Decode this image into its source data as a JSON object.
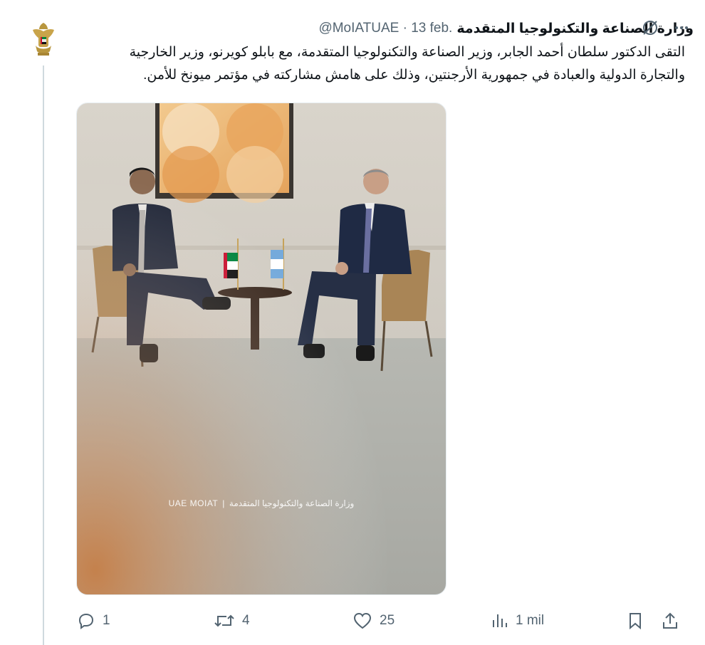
{
  "tweet": {
    "author_name": "وزارة الصناعة والتكنولوجيا المتقدمة",
    "handle": "@MoIATUAE",
    "separator": "·",
    "date": "13 feb.",
    "text": "التقى الدكتور سلطان أحمد الجابر، وزير الصناعة والتكنولوجيا المتقدمة، مع بابلو كويرنو، وزير الخارجية والتجارة الدولية والعبادة في جمهورية الأرجنتين، وذلك على هامش مشاركته في مؤتمر ميونخ للأمن."
  },
  "media": {
    "watermark_left": "UAE MOIAT",
    "watermark_sep": "|",
    "watermark_right": "وزارة الصناعة والتكنولوجيا المتقدمة"
  },
  "actions": {
    "reply_count": "1",
    "repost_count": "4",
    "like_count": "25",
    "views_count": "1 mil"
  },
  "colors": {
    "text": "#0f1419",
    "muted": "#536471",
    "thread_line": "#cfd9de"
  }
}
